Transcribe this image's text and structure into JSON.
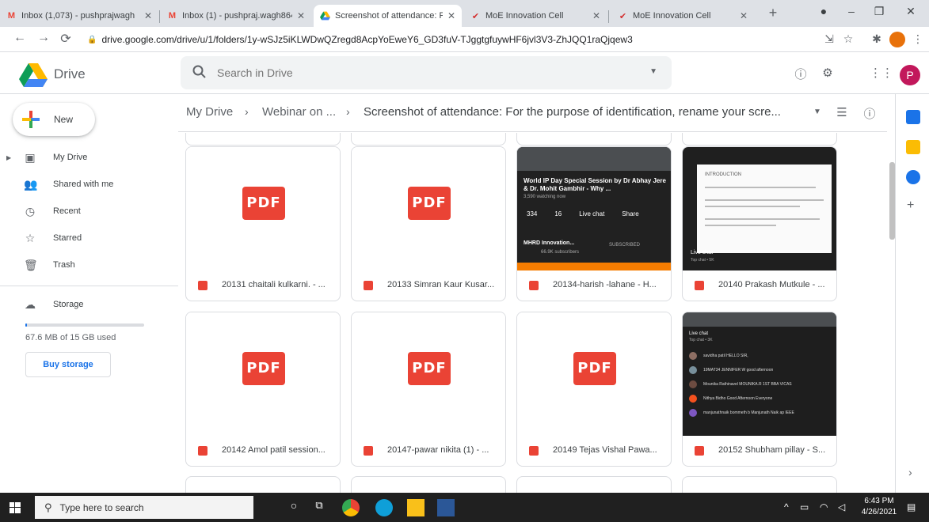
{
  "browser": {
    "tabs": [
      {
        "title": "Inbox (1,073) - pushprajwagh",
        "favicon": "gmail-icon"
      },
      {
        "title": "Inbox (1) - pushpraj.wagh864",
        "favicon": "gmail-icon"
      },
      {
        "title": "Screenshot of attendance: Fo",
        "favicon": "drive-icon",
        "active": true
      },
      {
        "title": "MoE Innovation Cell",
        "favicon": "moe-icon"
      },
      {
        "title": "MoE Innovation Cell",
        "favicon": "moe-icon"
      }
    ],
    "url": "drive.google.com/drive/u/1/folders/1y-wSJz5iKLWDwQZregd8AcpYoEweY6_GD3fuV-TJggtgfuywHF6jvl3V3-ZhJQQ1raQjqew3"
  },
  "drive": {
    "brand": "Drive",
    "search_placeholder": "Search in Drive",
    "new_label": "New",
    "nav": [
      {
        "label": "My Drive",
        "icon": "my-drive-icon"
      },
      {
        "label": "Shared with me",
        "icon": "shared-icon"
      },
      {
        "label": "Recent",
        "icon": "recent-icon"
      },
      {
        "label": "Starred",
        "icon": "star-icon"
      },
      {
        "label": "Trash",
        "icon": "trash-icon"
      }
    ],
    "storage_label": "Storage",
    "storage_used": "67.6 MB of 15 GB used",
    "storage_fraction": 0.0045,
    "buy_storage": "Buy storage",
    "breadcrumb": [
      "My Drive",
      "Webinar on ...",
      "Screenshot of attendance: For the purpose of identification, rename your scre..."
    ],
    "files": [
      {
        "name": "20131 chaitali kulkarni. - ...",
        "type": "pdf",
        "badge": "PDF"
      },
      {
        "name": "20133 Simran Kaur Kusar...",
        "type": "pdf",
        "badge": "PDF"
      },
      {
        "name": "20134-harish -lahane - H...",
        "type": "image"
      },
      {
        "name": "20140 Prakash Mutkule - ...",
        "type": "image"
      },
      {
        "name": "20142 Amol patil session...",
        "type": "pdf",
        "badge": "PDF"
      },
      {
        "name": "20147-pawar nikita (1) - ...",
        "type": "pdf",
        "badge": "PDF"
      },
      {
        "name": "20149 Tejas Vishal Pawa...",
        "type": "pdf",
        "badge": "PDF"
      },
      {
        "name": "20152 Shubham pillay - S...",
        "type": "image"
      }
    ],
    "thumb_text": {
      "yt_title": "World IP Day Special Session by Dr Abhay Jere & Dr. Mohit Gambhir - Why ...",
      "yt_watching": "3,590 watching now",
      "yt_actions": [
        "334",
        "16",
        "Live chat",
        "Share"
      ],
      "yt_channel": "MHRD Innovation...",
      "yt_subs": "66.9K subscribers",
      "yt_subscribed": "SUBSCRIBED",
      "slide_heading": "INTRODUCTION",
      "slide_chat": "Live chat",
      "slide_topchat": "Top chat  • 5K",
      "chat_header": "Live chat",
      "chat_top": "Top chat • 3K",
      "chat_rows": [
        "savidha patil  HELLO SIR,",
        "19MAT34 JENNIFER W  good afternoon",
        "Mounika Rathinavel  MOUNIKA.R 1ST BBA VICAS",
        "Nithya Bidho  Good Afternoon Everyone",
        "manjunathnaik bommeth  b Manjunath Naik ap IEEE"
      ]
    }
  },
  "taskbar": {
    "search_placeholder": "Type here to search",
    "time": "6:43 PM",
    "date": "4/26/2021"
  },
  "colors": {
    "accent": "#1a73e8",
    "pdf_red": "#ea4335",
    "taskbar": "#202020"
  }
}
